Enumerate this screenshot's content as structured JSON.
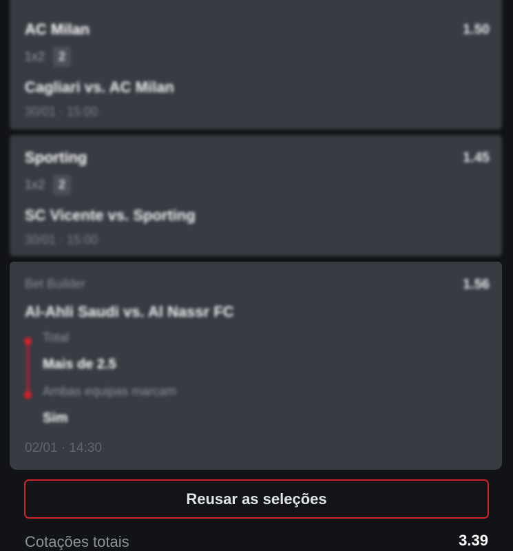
{
  "selections": [
    {
      "team": "AC Milan",
      "odd": "1.50",
      "market": "1x2",
      "pick_badge": "2",
      "match": "Cagliari vs. AC Milan",
      "datetime": "30/01 · 15:00"
    },
    {
      "team": "Sporting",
      "odd": "1.45",
      "market": "1x2",
      "pick_badge": "2",
      "match": "SC Vicente vs. Sporting",
      "datetime": "30/01 · 15:00"
    }
  ],
  "bet_builder": {
    "label": "Bet Builder",
    "odd": "1.56",
    "match": "Al-Ahli Saudi vs. Al Nassr FC",
    "legs": [
      {
        "market": "Total",
        "selection": "Mais de 2.5"
      },
      {
        "market": "Ambas equipas marcam",
        "selection": "Sim"
      }
    ],
    "datetime": "02/01 · 14:30"
  },
  "actions": {
    "reuse_label": "Reusar as seleções"
  },
  "totals": {
    "label": "Cotações totais",
    "value": "3.39"
  },
  "colors": {
    "card_bg": "#373b42",
    "page_bg": "#111317",
    "accent_red": "#d1232d"
  }
}
